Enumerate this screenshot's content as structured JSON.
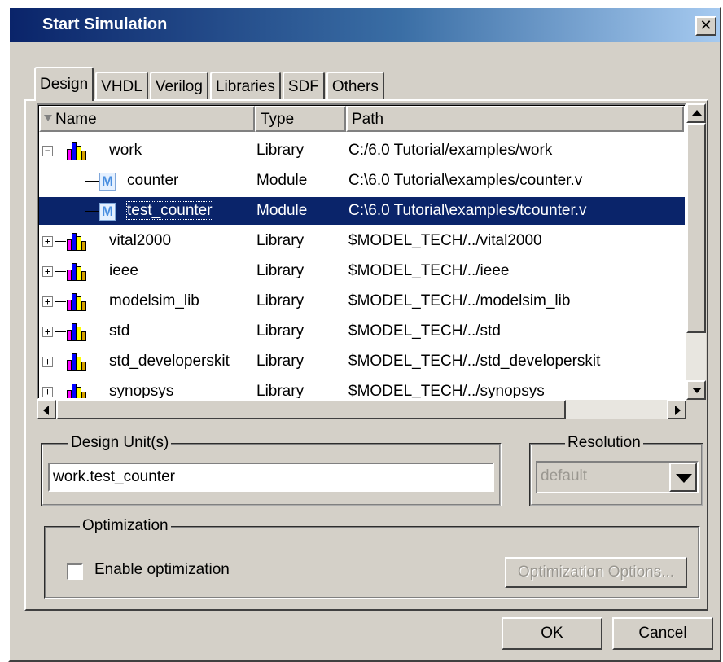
{
  "window": {
    "title": "Start Simulation",
    "close_glyph": "✕"
  },
  "tabs": [
    {
      "label": "Design",
      "active": true
    },
    {
      "label": "VHDL"
    },
    {
      "label": "Verilog"
    },
    {
      "label": "Libraries"
    },
    {
      "label": "SDF"
    },
    {
      "label": "Others"
    }
  ],
  "tree": {
    "columns": {
      "name": "Name",
      "type": "Type",
      "path": "Path"
    },
    "rows": [
      {
        "name": "work",
        "type": "Library",
        "path": "C:/6.0 Tutorial/examples/work",
        "kind": "library",
        "expander": "−"
      },
      {
        "name": "counter",
        "type": "Module",
        "path": "C:\\6.0 Tutorial\\examples/counter.v",
        "kind": "module",
        "icon_letter": "M"
      },
      {
        "name": "test_counter",
        "type": "Module",
        "path": "C:\\6.0 Tutorial\\examples/tcounter.v",
        "kind": "module",
        "icon_letter": "M",
        "selected": true
      },
      {
        "name": "vital2000",
        "type": "Library",
        "path": "$MODEL_TECH/../vital2000",
        "kind": "library",
        "expander": "+"
      },
      {
        "name": "ieee",
        "type": "Library",
        "path": "$MODEL_TECH/../ieee",
        "kind": "library",
        "expander": "+"
      },
      {
        "name": "modelsim_lib",
        "type": "Library",
        "path": "$MODEL_TECH/../modelsim_lib",
        "kind": "library",
        "expander": "+"
      },
      {
        "name": "std",
        "type": "Library",
        "path": "$MODEL_TECH/../std",
        "kind": "library",
        "expander": "+"
      },
      {
        "name": "std_developerskit",
        "type": "Library",
        "path": "$MODEL_TECH/../std_developerskit",
        "kind": "library",
        "expander": "+"
      },
      {
        "name": "synopsys",
        "type": "Library",
        "path": "$MODEL_TECH/../synopsys",
        "kind": "library",
        "expander": "+"
      }
    ]
  },
  "design_units": {
    "legend": "Design Unit(s)",
    "value": "work.test_counter"
  },
  "resolution": {
    "legend": "Resolution",
    "value": "default"
  },
  "optimization": {
    "legend": "Optimization",
    "checkbox_label": "Enable optimization",
    "checked": false,
    "options_button": "Optimization Options..."
  },
  "footer": {
    "ok": "OK",
    "cancel": "Cancel"
  },
  "colors": {
    "selection": "#0a246a",
    "face": "#d4d0c8",
    "title_start": "#0a246a",
    "title_end": "#a6caf0"
  }
}
